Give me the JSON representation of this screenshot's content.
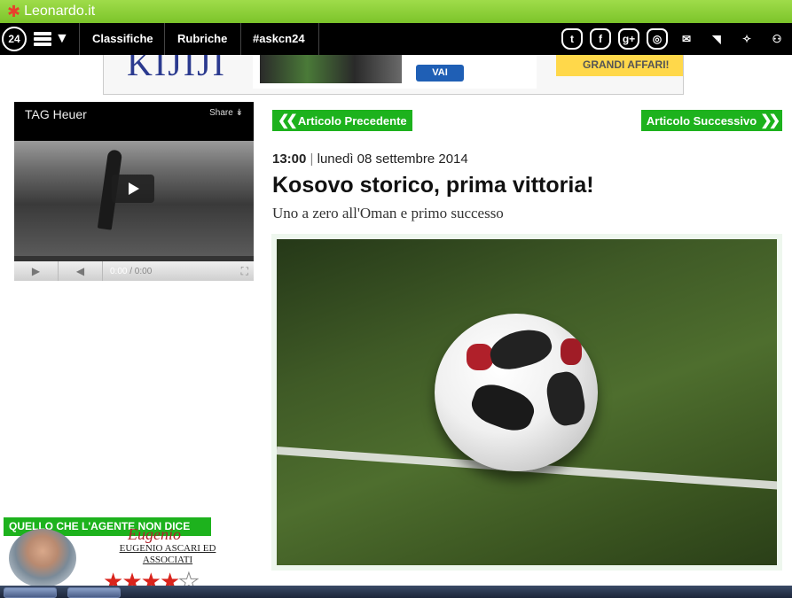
{
  "topbar": {
    "site_name": "Leonardo.it"
  },
  "nav": {
    "badge_24": "24",
    "links": [
      "Classifiche",
      "Rubriche",
      "#askcn24"
    ]
  },
  "banner": {
    "brand": "KIJIJI",
    "cta": "VAI",
    "promo": "GRANDI AFFARI!"
  },
  "video": {
    "title": "TAG Heuer",
    "share_label": "Share",
    "time_current": "0:00",
    "time_total": "/ 0:00"
  },
  "article": {
    "prev_label": "Articolo Precedente",
    "next_label": "Articolo Successivo",
    "time": "13:00",
    "separator": "|",
    "date": "lunedì 08 settembre 2014",
    "headline": "Kosovo storico, prima vittoria!",
    "subheadline": "Uno a zero all'Oman e primo successo"
  },
  "agent": {
    "banner": "QUELLO CHE L'AGENTE NON DICE",
    "signature": "Eugenio",
    "firm": "EUGENIO ASCARI ED ASSOCIATI",
    "rating_filled": 4,
    "rating_total": 5
  },
  "colors": {
    "accent_green": "#1db21d",
    "top_green": "#8ccf36",
    "nav_black": "#000000"
  }
}
